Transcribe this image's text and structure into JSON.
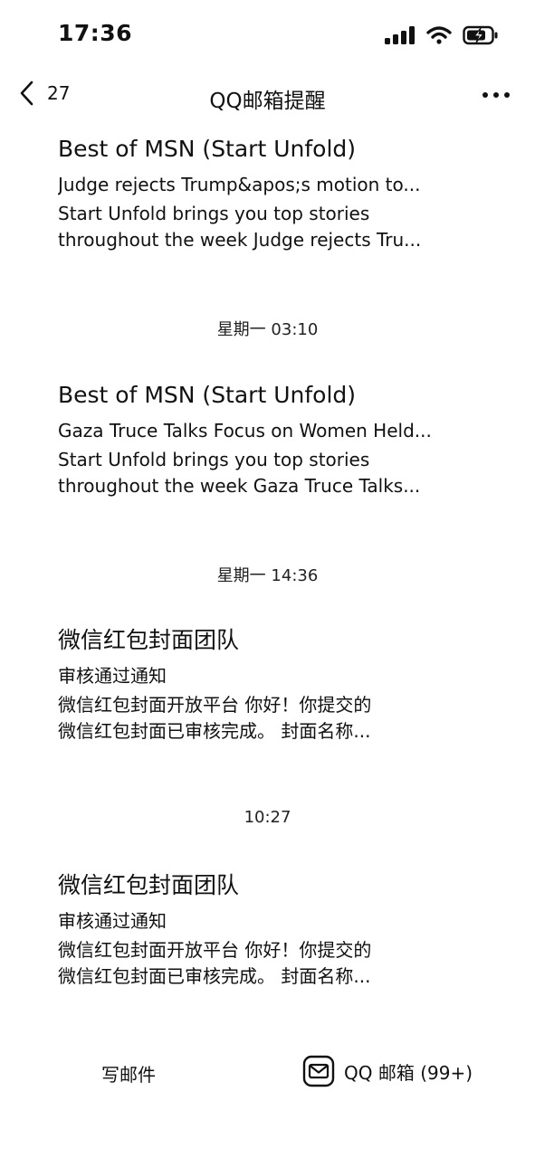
{
  "status_bar": {
    "time": "17:36",
    "icons": [
      "signal-icon",
      "wifi-icon",
      "battery-charging-icon"
    ]
  },
  "nav": {
    "back_count": "27",
    "title": "QQ邮箱提醒"
  },
  "messages": [
    {
      "sender": "Best of MSN (Start Unfold)",
      "subject": "Judge rejects Trump&apos;s motion to...",
      "preview": "Start Unfold brings you top stories\nthroughout the week   Judge rejects Tru..."
    },
    {
      "time": "星期一 03:10",
      "sender": "Best of MSN (Start Unfold)",
      "subject": "Gaza Truce Talks Focus on Women Held...",
      "preview": "Start Unfold brings you top stories\nthroughout the week   Gaza Truce Talks..."
    },
    {
      "time": "星期一 14:36",
      "sender": "微信红包封面团队",
      "subject": "审核通过通知",
      "preview": "微信红包封面开放平台      你好！你提交的\n微信红包封面已审核完成。    封面名称..."
    },
    {
      "time": "10:27",
      "sender": "微信红包封面团队",
      "subject": "审核通过通知",
      "preview": "微信红包封面开放平台      你好！你提交的\n微信红包封面已审核完成。    封面名称..."
    }
  ],
  "bottom": {
    "compose_label": "写邮件",
    "qqmail_label": "QQ 邮箱 (99+)"
  }
}
